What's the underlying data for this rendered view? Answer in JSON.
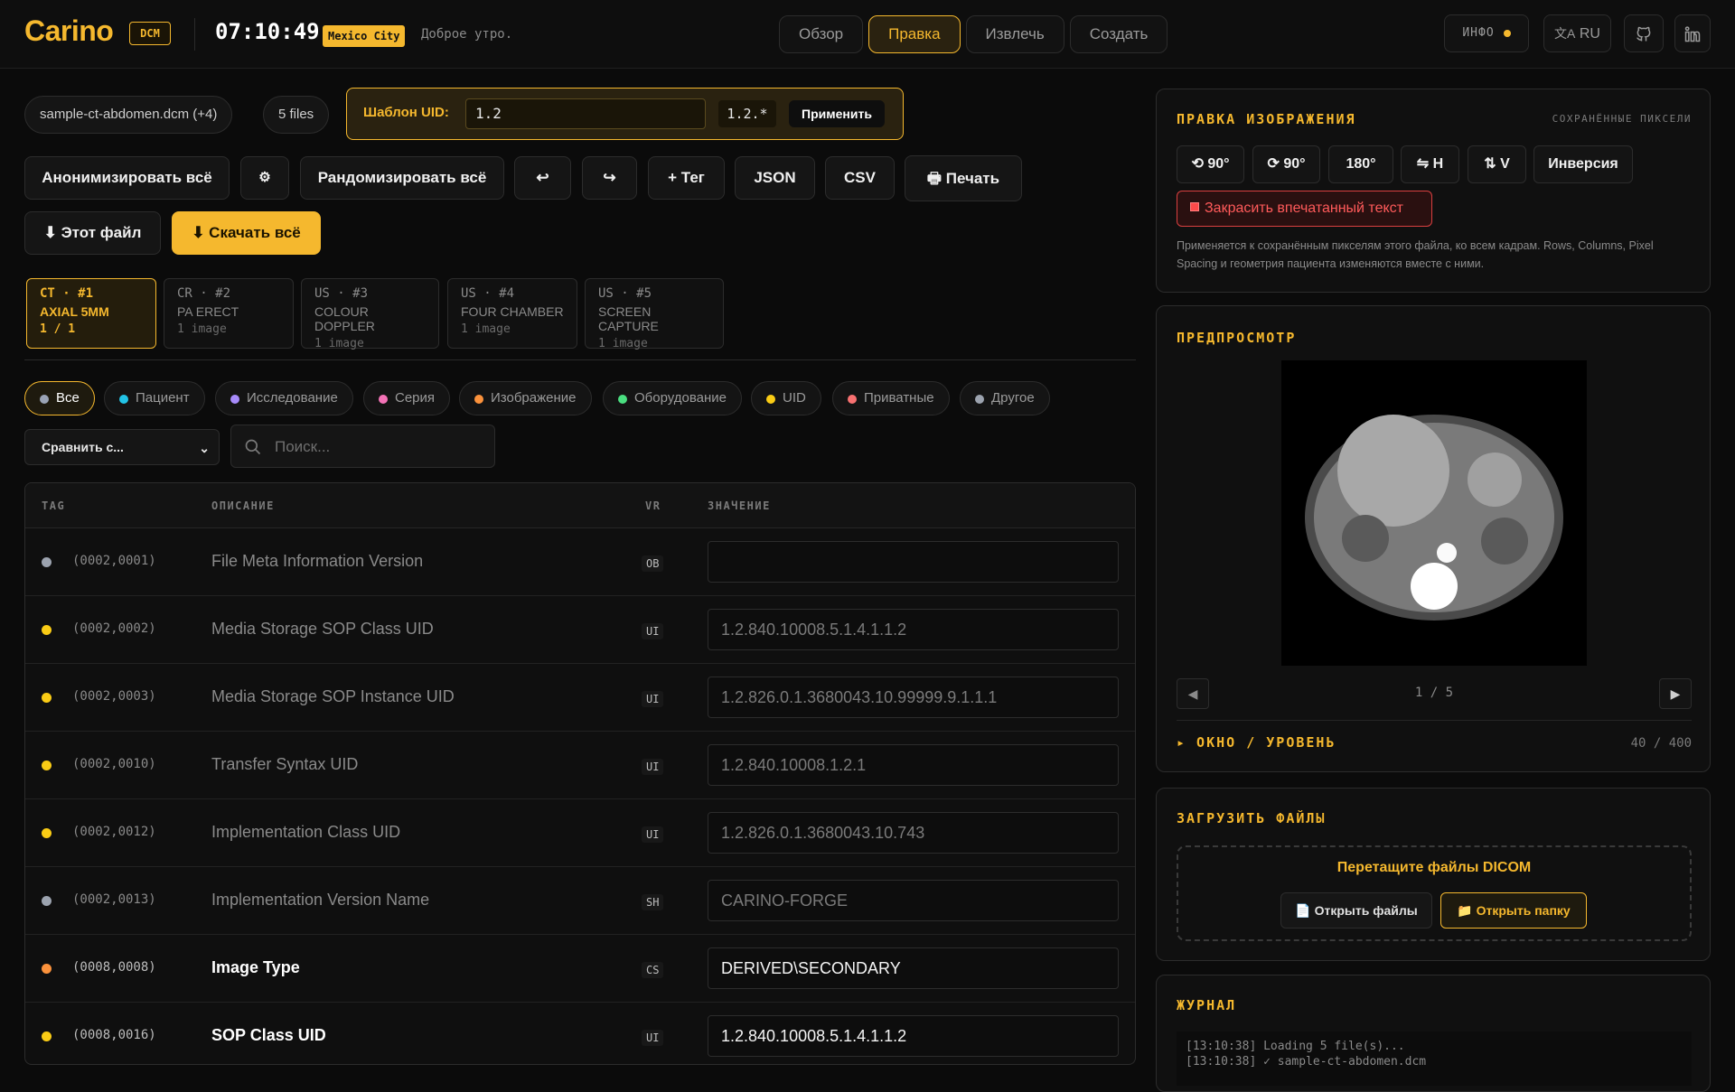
{
  "header": {
    "logo": "Carino",
    "badge": "DCM",
    "clock": "07:10:49",
    "city": "Mexico City",
    "greeting": "Доброе утро.",
    "tabs": [
      "Обзор",
      "Правка",
      "Извлечь",
      "Создать"
    ],
    "active_tab": "Правка",
    "info_label": "ИНФО",
    "lang_label": "RU"
  },
  "files": {
    "current": "sample-ct-abdomen.dcm (+4)",
    "count": "5 files"
  },
  "uid_template": {
    "label": "Шаблон UID:",
    "value": "1.2",
    "suffix": "1.2.*",
    "apply": "Применить"
  },
  "actions": {
    "anonymize_all": "Анонимизировать всё",
    "settings_icon": "⚙",
    "randomize_all": "Рандомизировать всё",
    "undo_icon": "↩",
    "redo_icon": "↪",
    "add_tag": "+ Тег",
    "json": "JSON",
    "csv": "CSV",
    "print": "Печать",
    "this_file": "⬇ Этот файл",
    "download_all": "⬇ Скачать всё"
  },
  "series": [
    {
      "l1": "CT · #1",
      "l2": "AXIAL 5MM",
      "l3": "1 / 1",
      "active": true
    },
    {
      "l1": "CR · #2",
      "l2": "PA ERECT",
      "l3": "1 image",
      "active": false
    },
    {
      "l1": "US · #3",
      "l2": "COLOUR DOPPLER",
      "l3": "1 image",
      "active": false
    },
    {
      "l1": "US · #4",
      "l2": "FOUR CHAMBER",
      "l3": "1 image",
      "active": false
    },
    {
      "l1": "US · #5",
      "l2": "SCREEN CAPTURE",
      "l3": "1 image",
      "active": false
    }
  ],
  "filters": [
    {
      "label": "Все",
      "color": "#9aa3b5"
    },
    {
      "label": "Пациент",
      "color": "#22c3e6"
    },
    {
      "label": "Исследование",
      "color": "#a78bfa"
    },
    {
      "label": "Серия",
      "color": "#f472b6"
    },
    {
      "label": "Изображение",
      "color": "#fb923c"
    },
    {
      "label": "Оборудование",
      "color": "#4ade80"
    },
    {
      "label": "UID",
      "color": "#facc15"
    },
    {
      "label": "Приватные",
      "color": "#f87171"
    },
    {
      "label": "Другое",
      "color": "#9ca3af"
    }
  ],
  "compare": {
    "label": "Сравнить с..."
  },
  "search": {
    "placeholder": "Поиск..."
  },
  "table": {
    "headers": [
      "TAG",
      "ОПИСАНИЕ",
      "VR",
      "ЗНАЧЕНИЕ"
    ],
    "rows": [
      {
        "tag": "(0002,0001)",
        "desc": "File Meta Information Version",
        "vr": "OB",
        "value": "",
        "color": "#9ca3af",
        "bright": false
      },
      {
        "tag": "(0002,0002)",
        "desc": "Media Storage SOP Class UID",
        "vr": "UI",
        "value": "1.2.840.10008.5.1.4.1.1.2",
        "color": "#facc15",
        "bright": false
      },
      {
        "tag": "(0002,0003)",
        "desc": "Media Storage SOP Instance UID",
        "vr": "UI",
        "value": "1.2.826.0.1.3680043.10.99999.9.1.1.1",
        "color": "#facc15",
        "bright": false
      },
      {
        "tag": "(0002,0010)",
        "desc": "Transfer Syntax UID",
        "vr": "UI",
        "value": "1.2.840.10008.1.2.1",
        "color": "#facc15",
        "bright": false
      },
      {
        "tag": "(0002,0012)",
        "desc": "Implementation Class UID",
        "vr": "UI",
        "value": "1.2.826.0.1.3680043.10.743",
        "color": "#facc15",
        "bright": false
      },
      {
        "tag": "(0002,0013)",
        "desc": "Implementation Version Name",
        "vr": "SH",
        "value": "CARINO-FORGE",
        "color": "#9ca3af",
        "bright": false
      },
      {
        "tag": "(0008,0008)",
        "desc": "Image Type",
        "vr": "CS",
        "value": "DERIVED\\SECONDARY",
        "color": "#fb923c",
        "bright": true
      },
      {
        "tag": "(0008,0016)",
        "desc": "SOP Class UID",
        "vr": "UI",
        "value": "1.2.840.10008.5.1.4.1.1.2",
        "color": "#facc15",
        "bright": true
      }
    ]
  },
  "image_edit": {
    "title": "ПРАВКА ИЗОБРАЖЕНИЯ",
    "subtitle": "СОХРАНЁННЫЕ ПИКСЕЛИ",
    "buttons": [
      "⟲ 90°",
      "⟳ 90°",
      "180°",
      "⇋ H",
      "⇅ V",
      "Инверсия"
    ],
    "redact": "Закрасить впечатанный текст",
    "note": "Применяется к сохранённым пикселям этого файла, ко всем кадрам. Rows, Columns, Pixel Spacing и геометрия пациента изменяются вместе с ними."
  },
  "preview": {
    "title": "ПРЕДПРОСМОТР",
    "page": "1 / 5",
    "prev": "◀",
    "next": "▶",
    "wl_title": "▸ ОКНО / УРОВЕНЬ",
    "wl_value": "40 / 400"
  },
  "upload": {
    "title": "ЗАГРУЗИТЬ ФАЙЛЫ",
    "drop": "Перетащите файлы DICOM",
    "open_files": "📄 Открыть файлы",
    "open_folder": "📁 Открыть папку"
  },
  "log": {
    "title": "ЖУРНАЛ",
    "lines": [
      "[13:10:38] Loading 5 file(s)...",
      "[13:10:38] ✓ sample-ct-abdomen.dcm"
    ]
  }
}
